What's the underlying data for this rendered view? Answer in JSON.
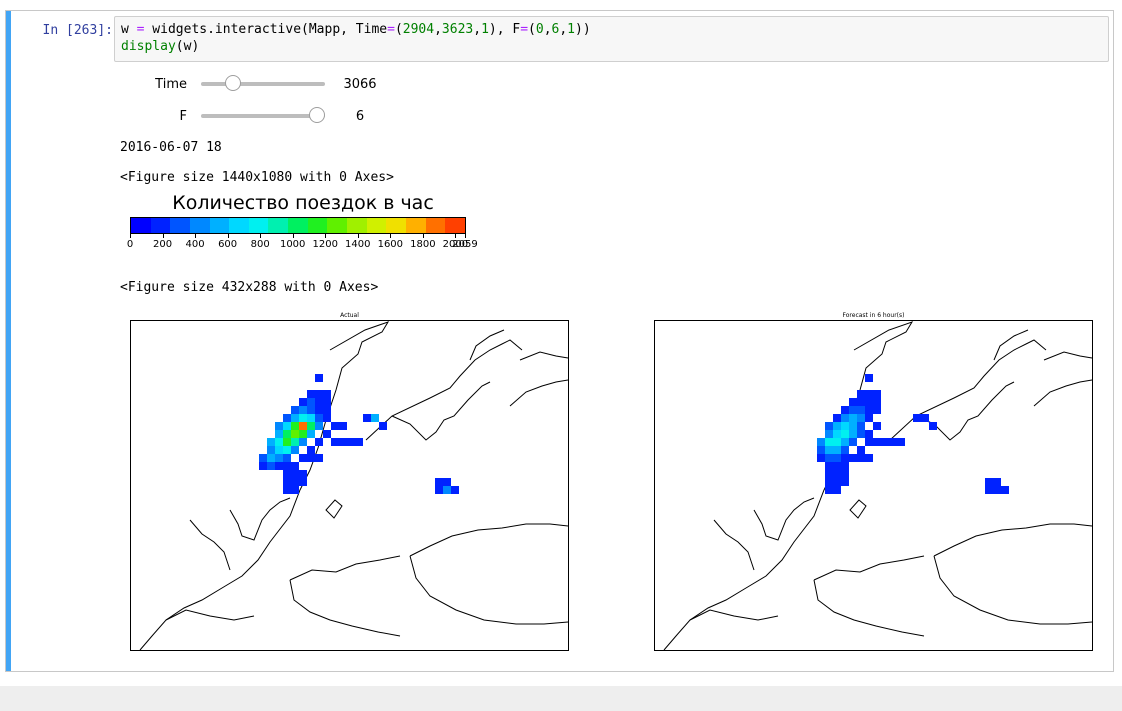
{
  "cell": {
    "prompt": "In [263]:",
    "code_lines": [
      "w = widgets.interactive(Mapp, Time=(2904,3623,1), F=(0,6,1))",
      "display(w)"
    ]
  },
  "widgets": [
    {
      "label": "Time",
      "min": 2904,
      "max": 3623,
      "value": 3066,
      "display": "3066"
    },
    {
      "label": "F",
      "min": 0,
      "max": 6,
      "value": 6,
      "display": "6"
    }
  ],
  "outputs": {
    "timestamp": "2016-06-07 18",
    "figure1": "<Figure size 1440x1080 with 0 Axes>",
    "figure2": "<Figure size 432x288 with 0 Axes>"
  },
  "colorbar": {
    "title": "Количество поездок в час",
    "min": 0,
    "max": 2059,
    "ticks": [
      "0",
      "200",
      "400",
      "600",
      "800",
      "1000",
      "1200",
      "1400",
      "1600",
      "1800",
      "2000",
      "2059"
    ],
    "tick_values": [
      0,
      200,
      400,
      600,
      800,
      1000,
      1200,
      1400,
      1600,
      1800,
      2000,
      2059
    ],
    "colors": [
      "#0000ff",
      "#0022ff",
      "#0055ff",
      "#0088ff",
      "#00b0ff",
      "#00d8ff",
      "#00f0f0",
      "#00f0b0",
      "#00f060",
      "#20f020",
      "#60f000",
      "#a0f000",
      "#d0f000",
      "#f0e000",
      "#ffb000",
      "#ff7000",
      "#ff4000"
    ]
  },
  "maps": [
    {
      "title": "Actual"
    },
    {
      "title": "Forecast in 6 hour(s)"
    }
  ],
  "colors": {
    "accent": "#42a5f5",
    "prompt": "#303f9f"
  }
}
